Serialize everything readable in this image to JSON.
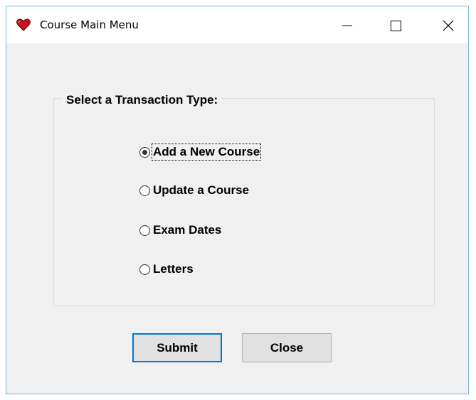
{
  "window": {
    "title": "Course Main Menu"
  },
  "group": {
    "label": "Select a Transaction Type:"
  },
  "options": [
    {
      "label": "Add a New Course",
      "checked": true
    },
    {
      "label": "Update a Course",
      "checked": false
    },
    {
      "label": "Exam Dates",
      "checked": false
    },
    {
      "label": "Letters",
      "checked": false
    }
  ],
  "buttons": {
    "submit_label": "Submit",
    "close_label": "Close"
  },
  "colors": {
    "accent": "#0078d7",
    "window_border": "#7ab6d9",
    "icon": "#c0141e"
  },
  "icons": {
    "app": "heart-icon",
    "minimize": "minimize-icon",
    "maximize": "maximize-icon",
    "close": "close-icon"
  }
}
